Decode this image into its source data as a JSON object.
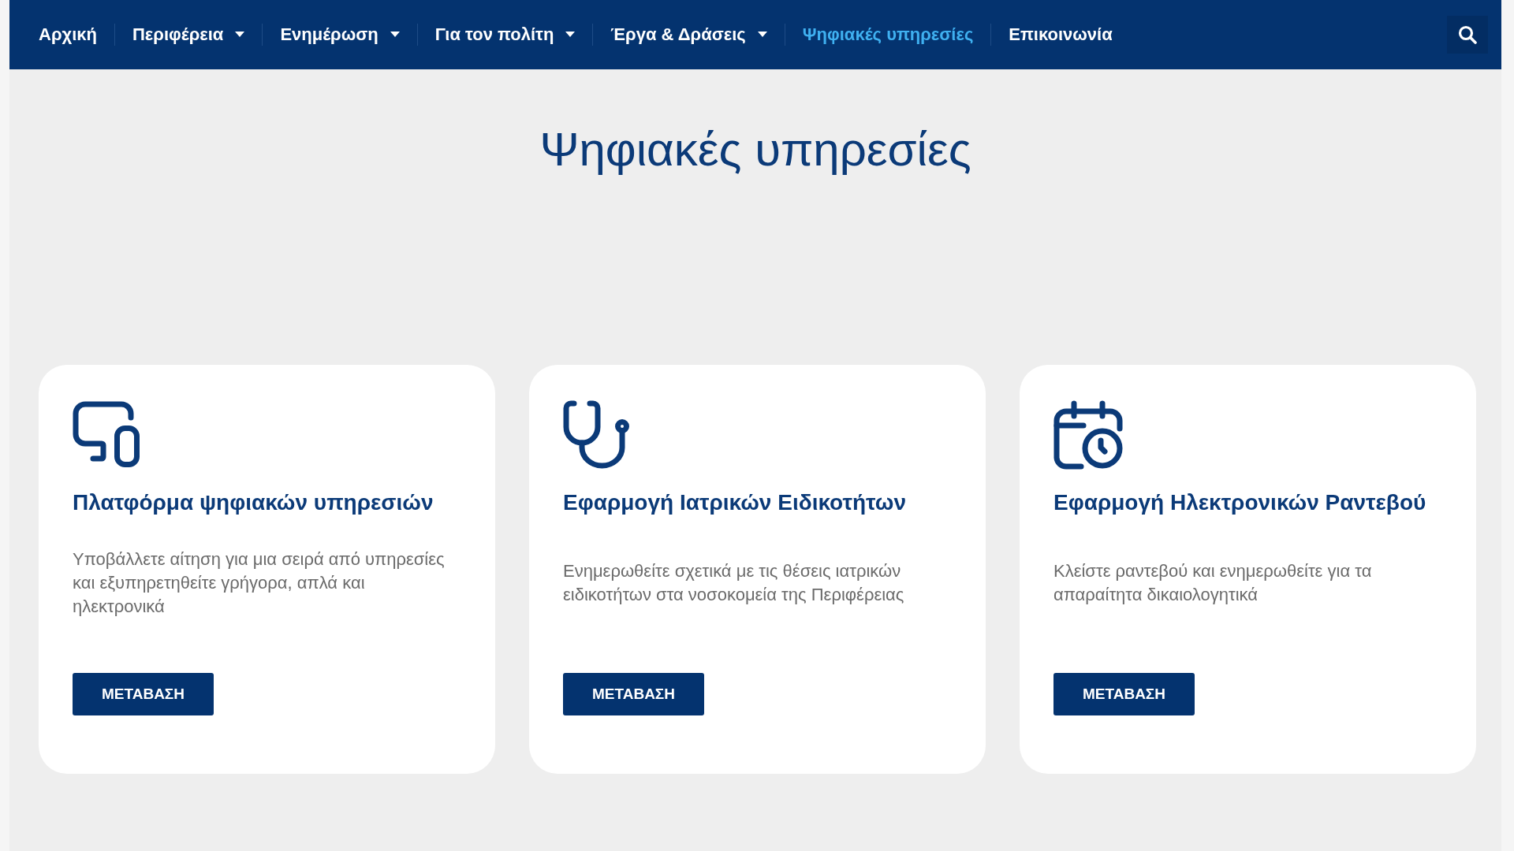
{
  "nav": {
    "items": [
      {
        "label": "Αρχική",
        "selected": false,
        "dropdown": false
      },
      {
        "label": "Περιφέρεια",
        "selected": false,
        "dropdown": true
      },
      {
        "label": "Ενημέρωση",
        "selected": false,
        "dropdown": true
      },
      {
        "label": "Για τον πολίτη",
        "selected": false,
        "dropdown": true
      },
      {
        "label": "Έργα & Δράσεις",
        "selected": false,
        "dropdown": true
      },
      {
        "label": "Ψηφιακές υπηρεσίες",
        "selected": true,
        "dropdown": false
      },
      {
        "label": "Επικοινωνία",
        "selected": false,
        "dropdown": false
      }
    ]
  },
  "page_title": "Ψηφιακές υπηρεσίες",
  "cards": [
    {
      "kind": "devices",
      "title": "Πλατφόρμα ψηφιακών υπηρεσιών",
      "description": "Υποβάλλετε αίτηση για μια σειρά από υπηρεσίες και εξυπηρετηθείτε γρήγορα, απλά και ηλεκτρονικά",
      "button": "ΜΕΤΑΒΑΣΗ"
    },
    {
      "kind": "stethoscope",
      "title": "Εφαρμογή Ιατρικών Ειδικοτήτων",
      "description": "Ενημερωθείτε σχετικά με τις θέσεις ιατρικών ειδικοτήτων στα νοσοκομεία της Περιφέρειας",
      "button": "ΜΕΤΑΒΑΣΗ"
    },
    {
      "kind": "calendar",
      "title": "Εφαρμογή Ηλεκτρονικών Ραντεβού",
      "description": "Κλείστε ραντεβού και ενημερωθείτε για τα απαραίτητα δικαιολογητικά",
      "button": "ΜΕΤΑΒΑΣΗ"
    }
  ]
}
